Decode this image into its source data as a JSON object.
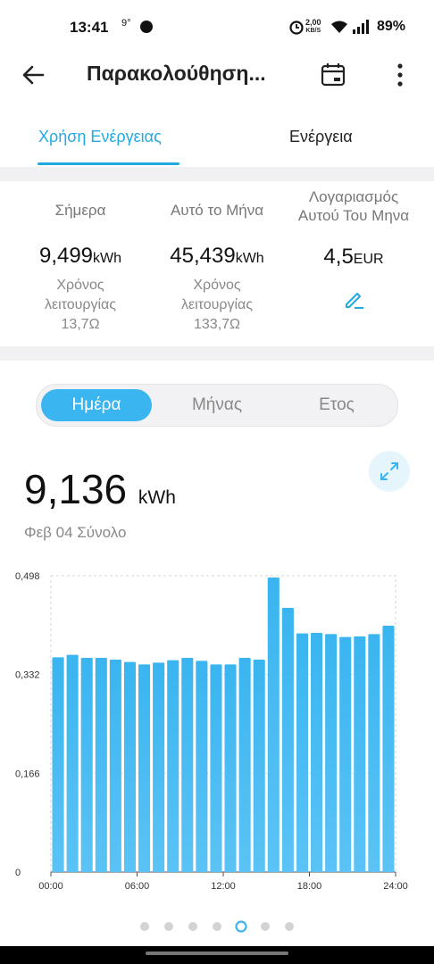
{
  "status_bar": {
    "time": "13:41",
    "notif": "9°",
    "speed_top": "2,00",
    "speed_bottom": "KB/S",
    "battery": "89%"
  },
  "app_bar": {
    "title": "Παρακολούθηση..."
  },
  "tabs": [
    {
      "label": "Χρήση Ενέργειας",
      "active": true
    },
    {
      "label": "Ενέργεια",
      "active": false
    }
  ],
  "summary": [
    {
      "label": "Σήμερα",
      "value": "9,499",
      "unit": "kWh",
      "sub1": "Χρόνος",
      "sub2": "λειτουργίας",
      "sub3": "13,7Ω"
    },
    {
      "label": "Αυτό το Μήνα",
      "value": "45,439",
      "unit": "kWh",
      "sub1": "Χρόνος",
      "sub2": "λειτουργίας",
      "sub3": "133,7Ω"
    },
    {
      "label1": "Λογαριασμός",
      "label2": "Αυτού Του Μηνα",
      "value": "4,5",
      "unit": "EUR"
    }
  ],
  "period": {
    "options": [
      "Ημέρα",
      "Μήνας",
      "Ετος"
    ],
    "selected": "Ημέρα"
  },
  "total": {
    "value": "9,136",
    "unit": "kWh",
    "caption": "Φεβ 04 Σύνολο"
  },
  "colors": {
    "accent": "#22a9e0",
    "bar": "#3ab5f0"
  },
  "chart_data": {
    "type": "bar",
    "ylim": [
      0,
      0.498
    ],
    "y_ticks": [
      "0,498",
      "0,332",
      "0,166",
      "0"
    ],
    "x_ticks": [
      "00:00",
      "06:00",
      "12:00",
      "18:00",
      "24:00"
    ],
    "categories": [
      "00",
      "01",
      "02",
      "03",
      "04",
      "05",
      "06",
      "07",
      "08",
      "09",
      "10",
      "11",
      "12",
      "13",
      "14",
      "15",
      "16",
      "17",
      "18",
      "19",
      "20",
      "21",
      "22",
      "23"
    ],
    "values": [
      0.361,
      0.365,
      0.36,
      0.36,
      0.357,
      0.353,
      0.349,
      0.352,
      0.356,
      0.36,
      0.355,
      0.349,
      0.349,
      0.36,
      0.357,
      0.495,
      0.444,
      0.401,
      0.402,
      0.4,
      0.395,
      0.396,
      0.4,
      0.414
    ],
    "grid": true
  },
  "pager": {
    "count": 7,
    "active": 4
  }
}
